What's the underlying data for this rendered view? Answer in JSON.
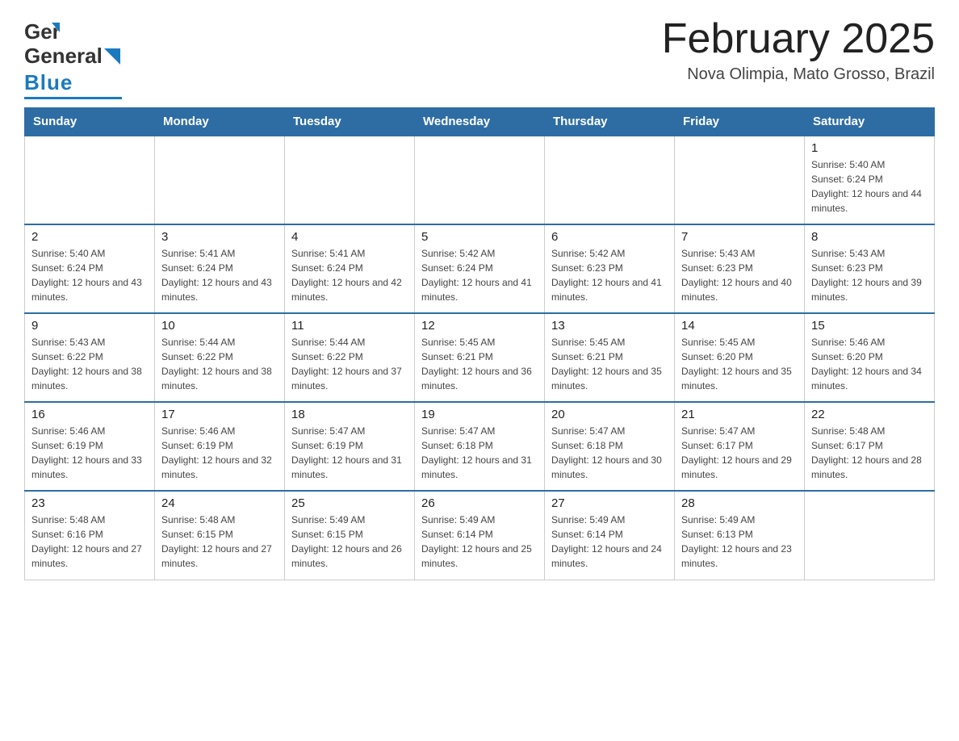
{
  "header": {
    "logo_general": "General",
    "logo_blue": "Blue",
    "month_title": "February 2025",
    "location": "Nova Olimpia, Mato Grosso, Brazil"
  },
  "days_of_week": [
    "Sunday",
    "Monday",
    "Tuesday",
    "Wednesday",
    "Thursday",
    "Friday",
    "Saturday"
  ],
  "weeks": [
    [
      {
        "day": "",
        "info": ""
      },
      {
        "day": "",
        "info": ""
      },
      {
        "day": "",
        "info": ""
      },
      {
        "day": "",
        "info": ""
      },
      {
        "day": "",
        "info": ""
      },
      {
        "day": "",
        "info": ""
      },
      {
        "day": "1",
        "info": "Sunrise: 5:40 AM\nSunset: 6:24 PM\nDaylight: 12 hours and 44 minutes."
      }
    ],
    [
      {
        "day": "2",
        "info": "Sunrise: 5:40 AM\nSunset: 6:24 PM\nDaylight: 12 hours and 43 minutes."
      },
      {
        "day": "3",
        "info": "Sunrise: 5:41 AM\nSunset: 6:24 PM\nDaylight: 12 hours and 43 minutes."
      },
      {
        "day": "4",
        "info": "Sunrise: 5:41 AM\nSunset: 6:24 PM\nDaylight: 12 hours and 42 minutes."
      },
      {
        "day": "5",
        "info": "Sunrise: 5:42 AM\nSunset: 6:24 PM\nDaylight: 12 hours and 41 minutes."
      },
      {
        "day": "6",
        "info": "Sunrise: 5:42 AM\nSunset: 6:23 PM\nDaylight: 12 hours and 41 minutes."
      },
      {
        "day": "7",
        "info": "Sunrise: 5:43 AM\nSunset: 6:23 PM\nDaylight: 12 hours and 40 minutes."
      },
      {
        "day": "8",
        "info": "Sunrise: 5:43 AM\nSunset: 6:23 PM\nDaylight: 12 hours and 39 minutes."
      }
    ],
    [
      {
        "day": "9",
        "info": "Sunrise: 5:43 AM\nSunset: 6:22 PM\nDaylight: 12 hours and 38 minutes."
      },
      {
        "day": "10",
        "info": "Sunrise: 5:44 AM\nSunset: 6:22 PM\nDaylight: 12 hours and 38 minutes."
      },
      {
        "day": "11",
        "info": "Sunrise: 5:44 AM\nSunset: 6:22 PM\nDaylight: 12 hours and 37 minutes."
      },
      {
        "day": "12",
        "info": "Sunrise: 5:45 AM\nSunset: 6:21 PM\nDaylight: 12 hours and 36 minutes."
      },
      {
        "day": "13",
        "info": "Sunrise: 5:45 AM\nSunset: 6:21 PM\nDaylight: 12 hours and 35 minutes."
      },
      {
        "day": "14",
        "info": "Sunrise: 5:45 AM\nSunset: 6:20 PM\nDaylight: 12 hours and 35 minutes."
      },
      {
        "day": "15",
        "info": "Sunrise: 5:46 AM\nSunset: 6:20 PM\nDaylight: 12 hours and 34 minutes."
      }
    ],
    [
      {
        "day": "16",
        "info": "Sunrise: 5:46 AM\nSunset: 6:19 PM\nDaylight: 12 hours and 33 minutes."
      },
      {
        "day": "17",
        "info": "Sunrise: 5:46 AM\nSunset: 6:19 PM\nDaylight: 12 hours and 32 minutes."
      },
      {
        "day": "18",
        "info": "Sunrise: 5:47 AM\nSunset: 6:19 PM\nDaylight: 12 hours and 31 minutes."
      },
      {
        "day": "19",
        "info": "Sunrise: 5:47 AM\nSunset: 6:18 PM\nDaylight: 12 hours and 31 minutes."
      },
      {
        "day": "20",
        "info": "Sunrise: 5:47 AM\nSunset: 6:18 PM\nDaylight: 12 hours and 30 minutes."
      },
      {
        "day": "21",
        "info": "Sunrise: 5:47 AM\nSunset: 6:17 PM\nDaylight: 12 hours and 29 minutes."
      },
      {
        "day": "22",
        "info": "Sunrise: 5:48 AM\nSunset: 6:17 PM\nDaylight: 12 hours and 28 minutes."
      }
    ],
    [
      {
        "day": "23",
        "info": "Sunrise: 5:48 AM\nSunset: 6:16 PM\nDaylight: 12 hours and 27 minutes."
      },
      {
        "day": "24",
        "info": "Sunrise: 5:48 AM\nSunset: 6:15 PM\nDaylight: 12 hours and 27 minutes."
      },
      {
        "day": "25",
        "info": "Sunrise: 5:49 AM\nSunset: 6:15 PM\nDaylight: 12 hours and 26 minutes."
      },
      {
        "day": "26",
        "info": "Sunrise: 5:49 AM\nSunset: 6:14 PM\nDaylight: 12 hours and 25 minutes."
      },
      {
        "day": "27",
        "info": "Sunrise: 5:49 AM\nSunset: 6:14 PM\nDaylight: 12 hours and 24 minutes."
      },
      {
        "day": "28",
        "info": "Sunrise: 5:49 AM\nSunset: 6:13 PM\nDaylight: 12 hours and 23 minutes."
      },
      {
        "day": "",
        "info": ""
      }
    ]
  ]
}
